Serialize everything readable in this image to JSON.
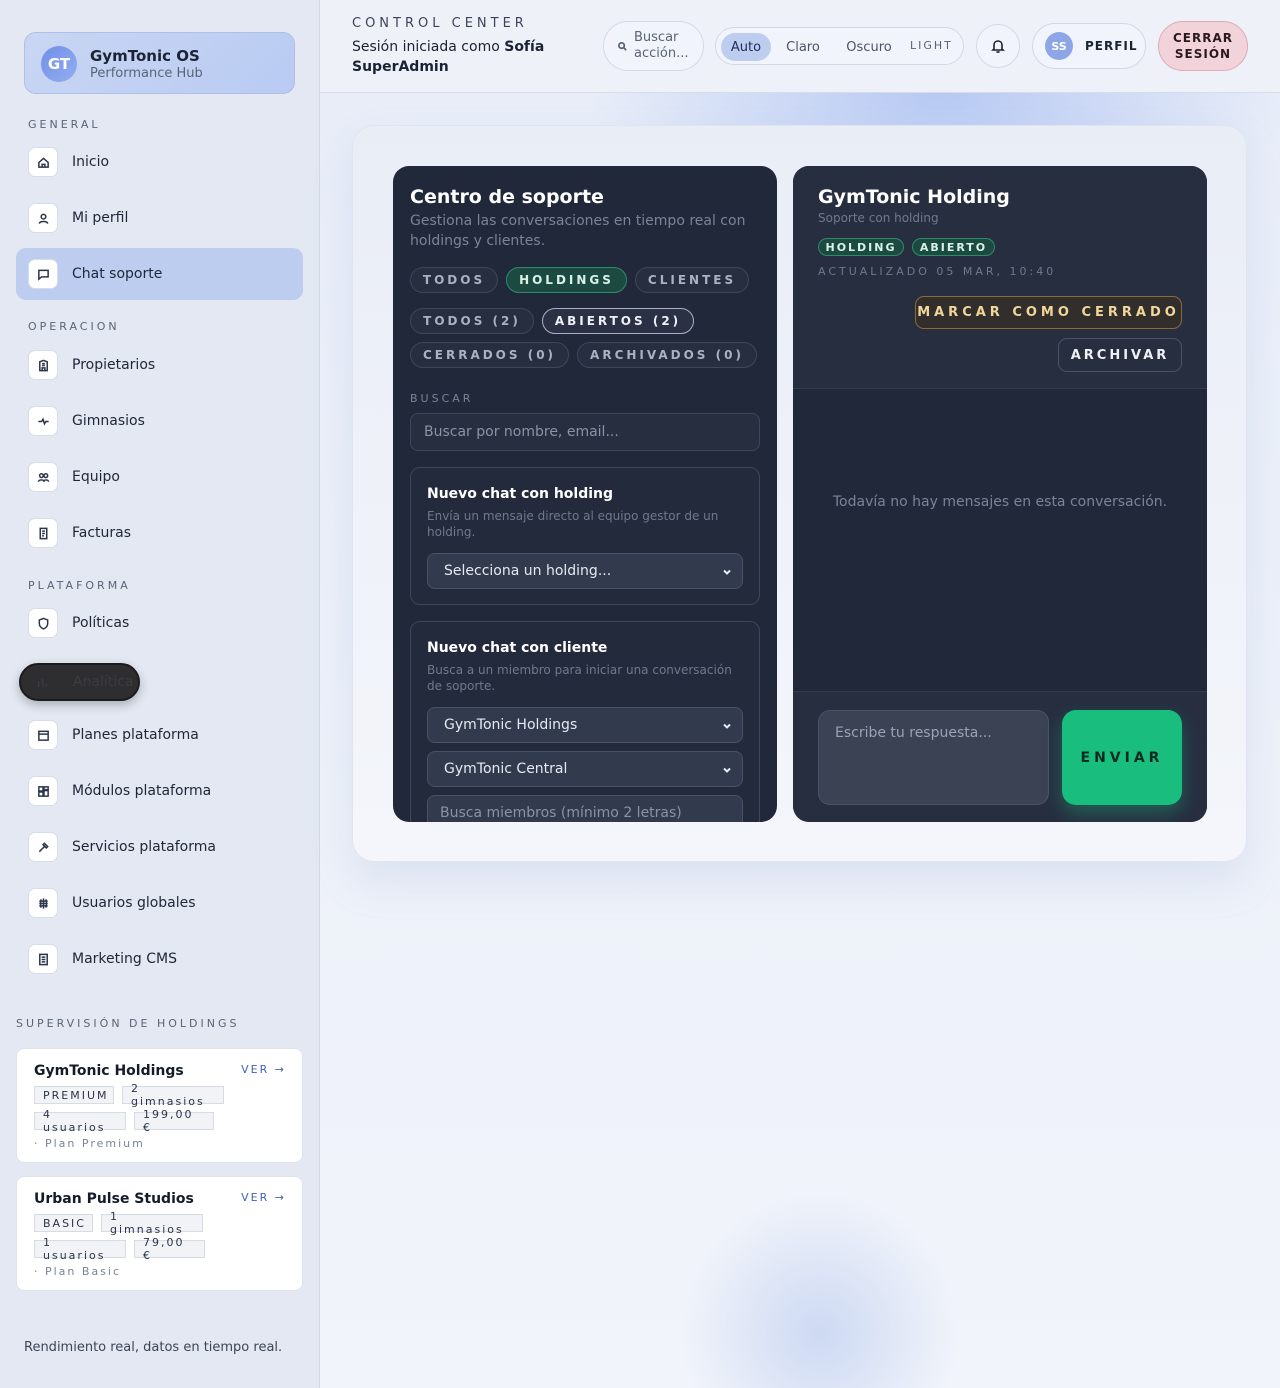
{
  "brand": {
    "initials": "GT",
    "name": "GymTonic OS",
    "subtitle": "Performance Hub"
  },
  "sidebar": {
    "sections": {
      "general": "GENERAL",
      "operacion": "OPERACION",
      "plataforma": "PLATAFORMA"
    },
    "items": [
      {
        "label": "Inicio",
        "icon": "home-icon"
      },
      {
        "label": "Mi perfil",
        "icon": "user-icon"
      },
      {
        "label": "Chat soporte",
        "icon": "chat-icon",
        "active": true
      },
      {
        "label": "Propietarios",
        "icon": "building-icon"
      },
      {
        "label": "Gimnasios",
        "icon": "pulse-icon"
      },
      {
        "label": "Equipo",
        "icon": "team-icon"
      },
      {
        "label": "Facturas",
        "icon": "invoice-icon"
      },
      {
        "label": "Políticas",
        "icon": "shield-icon"
      },
      {
        "label": "Analítica",
        "icon": "bar-chart-icon",
        "pressed": true
      },
      {
        "label": "Planes plataforma",
        "icon": "calendar-icon"
      },
      {
        "label": "Módulos plataforma",
        "icon": "modules-icon"
      },
      {
        "label": "Servicios plataforma",
        "icon": "wrench-icon"
      },
      {
        "label": "Usuarios globales",
        "icon": "globe-icon"
      },
      {
        "label": "Marketing CMS",
        "icon": "document-icon"
      }
    ],
    "supervision_title": "SUPERVISIÓN DE HOLDINGS",
    "holdings": [
      {
        "name": "GymTonic Holdings",
        "view": "VER →",
        "tier": "PREMIUM",
        "gyms": "2 gimnasios",
        "users": "4 usuarios",
        "price": "199,00 €",
        "plan": "· Plan Premium"
      },
      {
        "name": "Urban Pulse Studios",
        "view": "VER →",
        "tier": "BASIC",
        "gyms": "1 gimnasios",
        "users": "1 usuarios",
        "price": "79,00 €",
        "plan": "· Plan Basic"
      }
    ],
    "footer": "Rendimiento real, datos en tiempo real."
  },
  "header": {
    "label": "CONTROL CENTER",
    "session_prefix": "Sesión iniciada como",
    "session_user": "Sofía SuperAdmin",
    "search_placeholder": "Buscar acción...",
    "theme": {
      "auto": "Auto",
      "light_es": "Claro",
      "dark": "Oscuro",
      "current": "LIGHT"
    },
    "profile_initials": "SS",
    "profile_label": "PERFIL",
    "logout": "CERRAR SESIÓN"
  },
  "support": {
    "title": "Centro de soporte",
    "subtitle": "Gestiona las conversaciones en tiempo real con holdings y clientes.",
    "type_filters": [
      "TODOS",
      "HOLDINGS",
      "CLIENTES"
    ],
    "status_filters": [
      "TODOS (2)",
      "ABIERTOS (2)",
      "CERRADOS (0)",
      "ARCHIVADOS (0)"
    ],
    "search_label": "BUSCAR",
    "search_placeholder": "Buscar por nombre, email...",
    "new_holding": {
      "title": "Nuevo chat con holding",
      "desc": "Envía un mensaje directo al equipo gestor de un holding.",
      "select": "Selecciona un holding..."
    },
    "new_client": {
      "title": "Nuevo chat con cliente",
      "desc": "Busca a un miembro para iniciar una conversación de soporte.",
      "holding_select": "GymTonic Holdings",
      "gym_select": "GymTonic Central",
      "member_placeholder": "Busca miembros (mínimo 2 letras)"
    }
  },
  "conversation": {
    "title": "GymTonic Holding",
    "subtitle": "Soporte con holding",
    "badges": [
      "HOLDING",
      "ABIERTO"
    ],
    "updated": "ACTUALIZADO 05 MAR, 10:40",
    "mark_closed": "MARCAR COMO CERRADO",
    "archive": "ARCHIVAR",
    "empty": "Todavía no hay mensajes en esta conversación.",
    "reply_placeholder": "Escribe tu respuesta...",
    "send": "ENVIAR"
  }
}
